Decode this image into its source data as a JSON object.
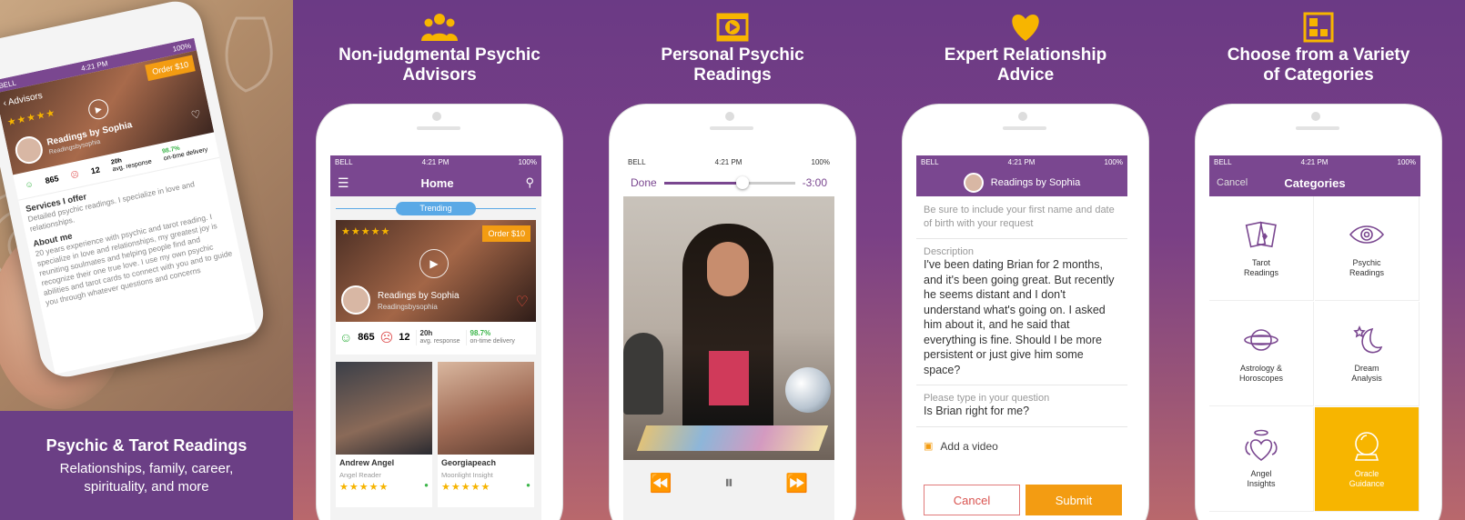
{
  "hero": {
    "title": "Psychic & Tarot Readings",
    "subtitle_line1": "Relationships, family, career,",
    "subtitle_line2": "spirituality, and more",
    "phone": {
      "carrier": "BELL",
      "time": "4:21 PM",
      "battery": "100%",
      "back_label": "Advisors",
      "order_label": "Order $10",
      "advisor_name": "Readings by Sophia",
      "advisor_handle": "Readingsbysophia",
      "happy_count": "865",
      "sad_count": "12",
      "response_value": "20h",
      "response_label": "avg. response",
      "ontime_value": "98.7%",
      "ontime_label": "on-time delivery",
      "services_heading": "Services I offer",
      "services_text": "Detailed psychic readings. I specialize in love and relationships.",
      "about_heading": "About me",
      "about_text": "20 years experience with psychic and tarot reading. I specialize in love and relationships, my greatest joy is reuniting soulmates and helping people find and recognize their one true love. I use my own psychic abilities and tarot cards to connect with you and to guide you through whatever questions and concerns"
    }
  },
  "panels": [
    {
      "title_line1": "Non-judgmental Psychic",
      "title_line2": "Advisors",
      "icon": "people-icon"
    },
    {
      "title_line1": "Personal Psychic",
      "title_line2": "Readings",
      "icon": "video-icon"
    },
    {
      "title_line1": "Expert Relationship",
      "title_line2": "Advice",
      "icon": "heart-icon"
    },
    {
      "title_line1": "Choose from a Variety",
      "title_line2": "of Categories",
      "icon": "grid-icon"
    }
  ],
  "status": {
    "carrier": "BELL",
    "time": "4:21 PM",
    "battery": "100%"
  },
  "home": {
    "title": "Home",
    "trending": "Trending",
    "order_label": "Order $10",
    "advisor_name": "Readings by Sophia",
    "advisor_handle": "Readingsbysophia",
    "happy_count": "865",
    "sad_count": "12",
    "response_value": "20h",
    "response_label": "avg. response",
    "ontime_value": "98.7%",
    "ontime_label": "on-time delivery",
    "tiles": [
      {
        "name": "Andrew Angel",
        "tag": "Angel Reader"
      },
      {
        "name": "Georgiapeach",
        "tag": "Moonlight Insight"
      }
    ]
  },
  "video": {
    "done_label": "Done",
    "remaining": "-3:00",
    "progress": 0.6
  },
  "request": {
    "advisor_name": "Readings by Sophia",
    "hint": "Be sure to include your first name and date of birth with your request",
    "description_label": "Description",
    "description_text": "I've been dating Brian for 2 months, and it's been going great. But recently he seems distant and I don't understand what's going on. I asked him about it, and he said that everything is fine. Should I be more persistent or just give him some space?",
    "question_label": "Please type in your question",
    "question_text": "Is Brian right for me?",
    "add_video": "Add a video",
    "cancel": "Cancel",
    "submit": "Submit"
  },
  "categories": {
    "cancel": "Cancel",
    "title": "Categories",
    "items": [
      {
        "line1": "Tarot",
        "line2": "Readings",
        "icon": "tarot-cards-icon"
      },
      {
        "line1": "Psychic",
        "line2": "Readings",
        "icon": "eye-icon"
      },
      {
        "line1": "Astrology &",
        "line2": "Horoscopes",
        "icon": "planet-icon"
      },
      {
        "line1": "Dream",
        "line2": "Analysis",
        "icon": "moon-star-icon"
      },
      {
        "line1": "Angel",
        "line2": "Insights",
        "icon": "angel-heart-icon"
      },
      {
        "line1": "Oracle",
        "line2": "Guidance",
        "icon": "crystal-ball-icon"
      }
    ]
  },
  "colors": {
    "purple": "#7a4790",
    "orange": "#f39c12",
    "yellow": "#f7b500",
    "accent_blue": "#5aa9e6"
  }
}
